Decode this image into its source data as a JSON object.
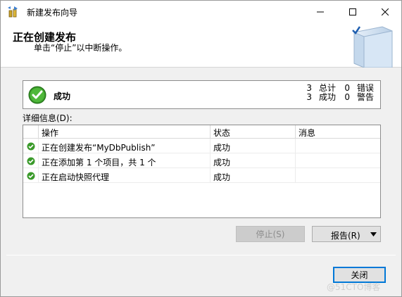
{
  "window": {
    "title": "新建发布向导",
    "minimize_icon": "minimize-icon",
    "maximize_icon": "maximize-icon",
    "close_icon": "close-icon"
  },
  "header": {
    "title": "正在创建发布",
    "subtitle": "单击“停止”以中断操作。"
  },
  "status": {
    "result": "成功",
    "total_count": "3",
    "total_label": "总计",
    "error_count": "0",
    "error_label": "错误",
    "success_count": "3",
    "success_label": "成功",
    "warning_count": "0",
    "warning_label": "警告",
    "icon": "check-circle-icon"
  },
  "details": {
    "label": "详细信息(D):",
    "columns": [
      "操作",
      "状态",
      "消息"
    ],
    "rows": [
      {
        "action": "正在创建发布“MyDbPublish”",
        "status": "成功",
        "message": ""
      },
      {
        "action": "正在添加第 1 个项目，共 1 个",
        "status": "成功",
        "message": ""
      },
      {
        "action": "正在启动快照代理",
        "status": "成功",
        "message": ""
      }
    ]
  },
  "buttons": {
    "stop": "停止(S)",
    "report": "报告(R)",
    "close": "关闭"
  },
  "watermark": "@51CTO博客",
  "colors": {
    "success_green": "#3a9a2a",
    "focus_blue": "#0078d7"
  }
}
